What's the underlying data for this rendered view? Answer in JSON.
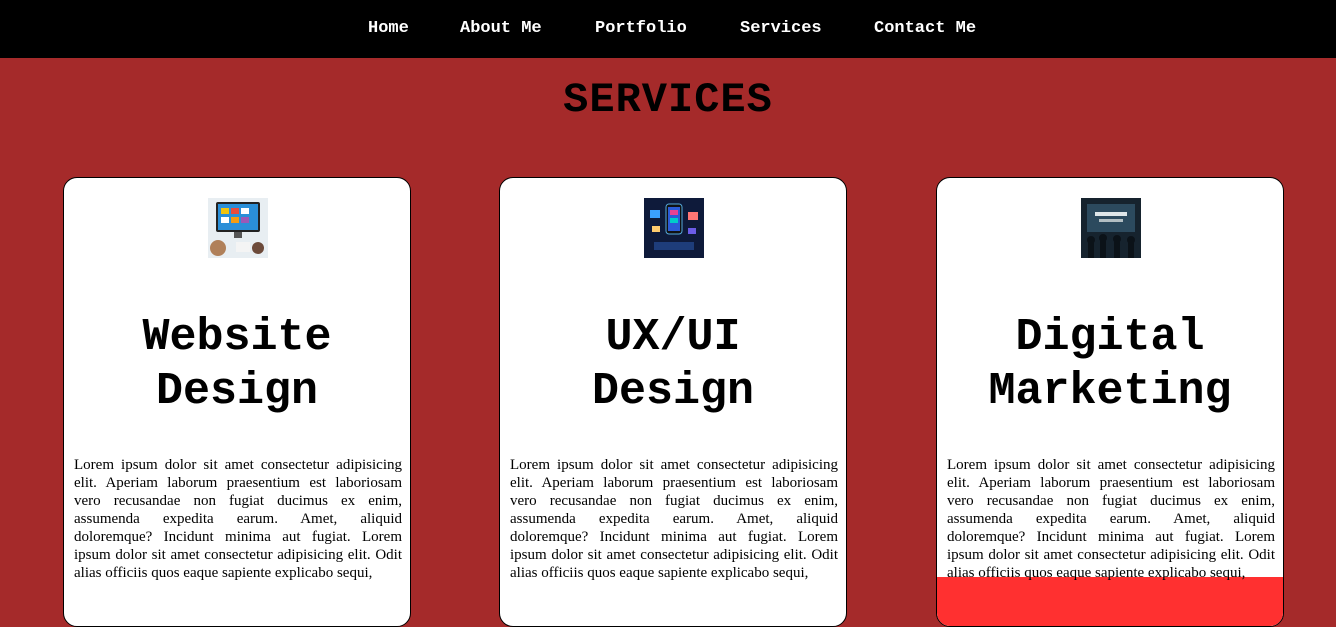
{
  "nav": {
    "items": [
      "Home",
      "About Me",
      "Portfolio",
      "Services",
      "Contact Me"
    ]
  },
  "page": {
    "title": "SERVICES"
  },
  "cards": [
    {
      "title_line1": "Website",
      "title_line2": "Design",
      "image": "website-design-image",
      "text": "Lorem ipsum dolor sit amet consectetur adipisicing elit. Aperiam laborum praesentium est laboriosam vero recusandae non fugiat ducimus ex enim, assumenda expedita earum. Amet, aliquid doloremque? Incidunt minima aut fugiat. Lorem ipsum dolor sit amet consectetur adipisicing elit. Odit alias officiis quos eaque sapiente explicabo sequi,"
    },
    {
      "title_line1": "UX/UI",
      "title_line2": "Design",
      "image": "ux-ui-design-image",
      "text": "Lorem ipsum dolor sit amet consectetur adipisicing elit. Aperiam laborum praesentium est laboriosam vero recusandae non fugiat ducimus ex enim, assumenda expedita earum. Amet, aliquid doloremque? Incidunt minima aut fugiat. Lorem ipsum dolor sit amet consectetur adipisicing elit. Odit alias officiis quos eaque sapiente explicabo sequi,"
    },
    {
      "title_line1": "Digital",
      "title_line2": "Marketing",
      "image": "digital-marketing-image",
      "text": "Lorem ipsum dolor sit amet consectetur adipisicing elit. Aperiam laborum praesentium est laboriosam vero recusandae non fugiat ducimus ex enim, assumenda expedita earum. Amet, aliquid doloremque? Incidunt minima aut fugiat. Lorem ipsum dolor sit amet consectetur adipisicing elit. Odit alias officiis quos eaque sapiente explicabo sequi,"
    }
  ],
  "colors": {
    "background": "#a52a2a",
    "navbar": "#000000",
    "card": "#ffffff",
    "hover_highlight": "#ff3030"
  }
}
